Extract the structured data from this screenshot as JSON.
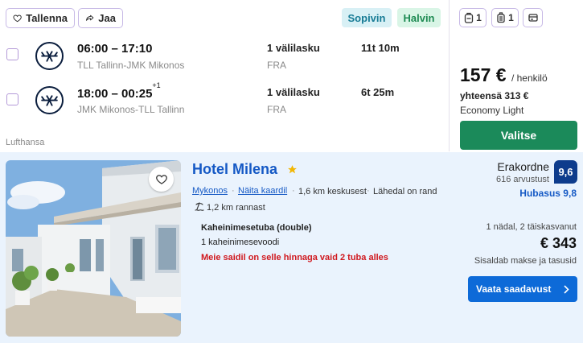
{
  "flight": {
    "save_label": "Tallenna",
    "share_label": "Jaa",
    "badges": {
      "sopivin": "Sopivin",
      "halvin": "Halvin"
    },
    "legs": [
      {
        "time": "06:00 – 17:10",
        "plus_days": "",
        "route": "TLL Tallinn-JMK Mikonos",
        "stops": "1 välilasku",
        "stop_code": "FRA",
        "duration": "11t 10m"
      },
      {
        "time": "18:00 – 00:25",
        "plus_days": "+1",
        "route": "JMK Mikonos-TLL Tallinn",
        "stops": "1 välilasku",
        "stop_code": "FRA",
        "duration": "6t 25m"
      }
    ],
    "airline": "Lufthansa",
    "bags": {
      "personal_count": "1",
      "cabin_count": "1"
    },
    "price": "157 €",
    "price_per": "/ henkilö",
    "price_total": "yhteensä 313 €",
    "cabin_class": "Economy Light",
    "select_label": "Valitse",
    "colors": {
      "select_bg": "#1b8a5a",
      "border_accent": "#c7b9e6"
    }
  },
  "hotel": {
    "name": "Hotel Milena",
    "city": "Mykonos",
    "separator": "·",
    "map_link": "Näita kaardil",
    "distance_center": "1,6 km keskusest",
    "nearby": "Lähedal on rand",
    "beach_distance": "1,2 km rannast",
    "room_type": "Kaheinimesetuba (double)",
    "bed_type": "1 kaheinimesevoodi",
    "scarcity": "Meie saidil on selle hinnaga vaid 2 tuba alles",
    "rating_word": "Erakordne",
    "reviews": "616 arvustust",
    "score": "9,6",
    "value_rating": "Hubasus 9,8",
    "stay_length": "1 nädal, 2 täiskasvanut",
    "price": "€ 343",
    "tax_note": "Sisaldab makse ja tasusid",
    "deal_label": "Vaata saadavust",
    "colors": {
      "link": "#1559c5",
      "score_bg": "#0e3c8c",
      "deal_bg": "#0d6ad8",
      "scarcity": "#d0191f",
      "card_bg": "#eaf3fd"
    }
  }
}
